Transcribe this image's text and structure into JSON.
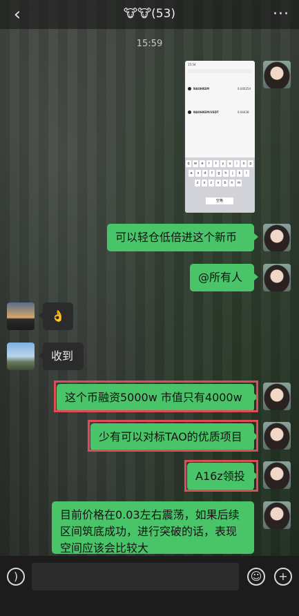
{
  "header": {
    "back_label": "‹",
    "title": "🐮🐮(53)",
    "more_label": "···"
  },
  "timestamp": "15:59",
  "shared_screenshot": {
    "status_time": "15:54",
    "row1_name": "NAOHKEM",
    "row1_value": "0.040254",
    "row2_name": "NAOHKEM/USDT",
    "row2_value": "0.04438",
    "keys_row1": [
      "q",
      "w",
      "e",
      "r",
      "t",
      "y",
      "u",
      "i",
      "o",
      "p"
    ],
    "keys_row2": [
      "a",
      "s",
      "d",
      "f",
      "g",
      "h",
      "j",
      "k",
      "l"
    ],
    "keys_row3": [
      "z",
      "x",
      "c",
      "v",
      "b",
      "n",
      "m"
    ],
    "space_label": "空格"
  },
  "messages": [
    {
      "side": "right",
      "text": "可以轻仓低倍进这个新币",
      "highlight": false
    },
    {
      "side": "right",
      "text": "@所有人",
      "highlight": false
    },
    {
      "side": "left",
      "text": "👌",
      "avatar": "sunset"
    },
    {
      "side": "left",
      "text": "收到",
      "avatar": "city"
    },
    {
      "side": "right",
      "text": "这个币融资5000w 市值只有4000w",
      "highlight": true
    },
    {
      "side": "right",
      "text": "少有可以对标TAO的优质项目",
      "highlight": true
    },
    {
      "side": "right",
      "text": "A16z领投",
      "highlight": true
    },
    {
      "side": "right",
      "text": "目前价格在0.03左右震荡，如果后续区间筑底成功，进行突破的话，表现空间应该会比较大",
      "highlight": false
    }
  ],
  "input_bar": {
    "voice_icon": "voice-icon",
    "emoji_icon": "emoji-icon",
    "plus_icon": "plus-icon"
  },
  "colors": {
    "green_bubble": "#4ac468",
    "highlight_red": "#e04b55",
    "dark_bubble": "#2b2b2b"
  }
}
